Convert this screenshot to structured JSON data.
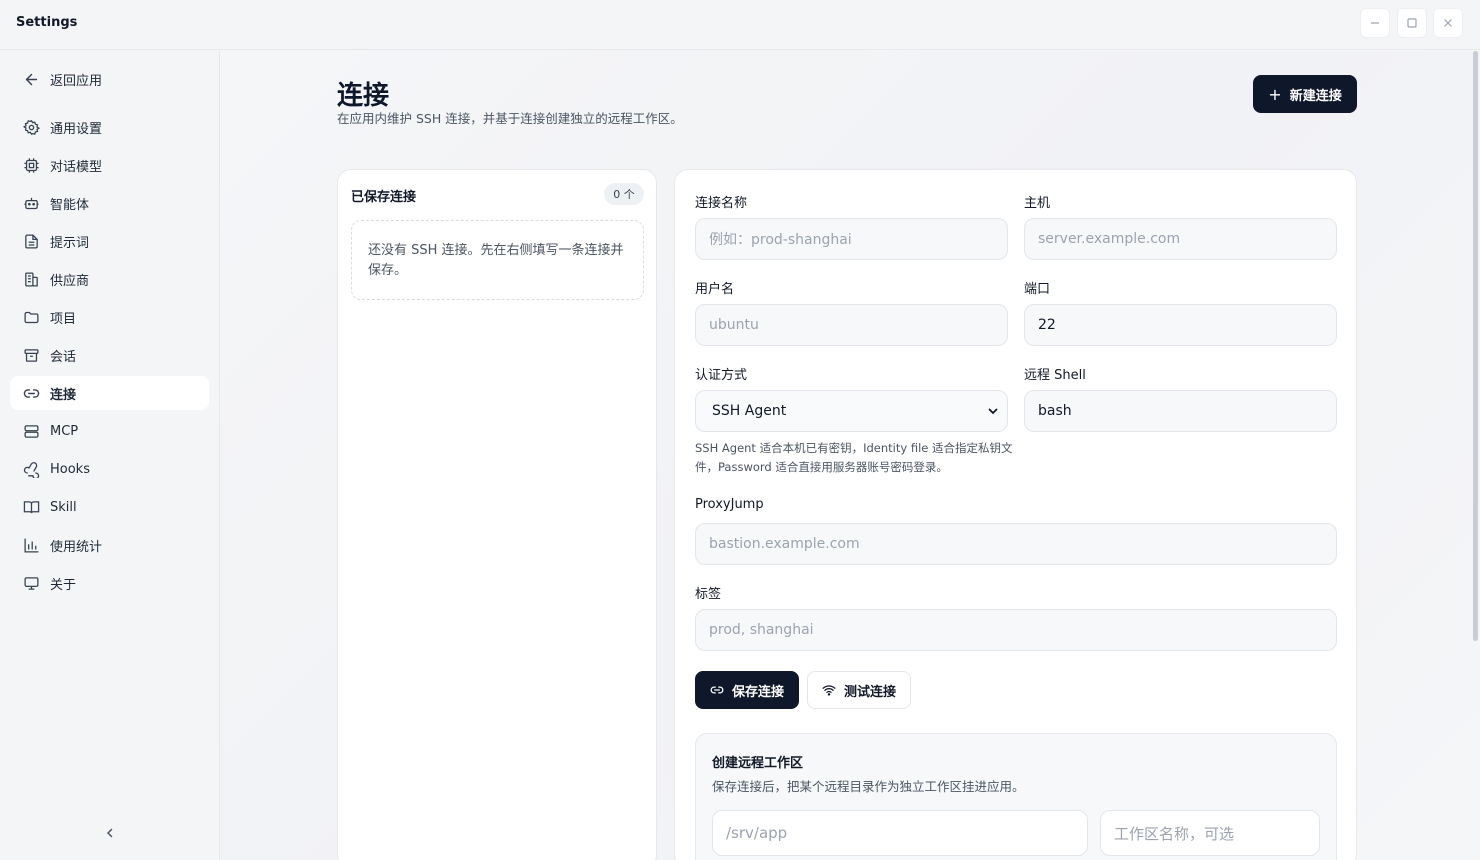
{
  "window": {
    "title": "Settings"
  },
  "sidebar": {
    "back_label": "返回应用",
    "items": [
      {
        "label": "通用设置",
        "icon": "gear-icon"
      },
      {
        "label": "对话模型",
        "icon": "cpu-icon"
      },
      {
        "label": "智能体",
        "icon": "bot-icon"
      },
      {
        "label": "提示词",
        "icon": "document-icon"
      },
      {
        "label": "供应商",
        "icon": "building-icon"
      },
      {
        "label": "项目",
        "icon": "folder-icon"
      },
      {
        "label": "会话",
        "icon": "archive-icon"
      },
      {
        "label": "连接",
        "icon": "link-icon",
        "active": true
      },
      {
        "label": "MCP",
        "icon": "server-icon"
      },
      {
        "label": "Hooks",
        "icon": "webhook-icon"
      },
      {
        "label": "Skill",
        "icon": "book-icon"
      },
      {
        "label": "使用统计",
        "icon": "chart-icon"
      },
      {
        "label": "关于",
        "icon": "monitor-icon"
      }
    ]
  },
  "header": {
    "title": "连接",
    "subtitle": "在应用内维护 SSH 连接，并基于连接创建独立的远程工作区。",
    "new_button": "新建连接"
  },
  "saved": {
    "title": "已保存连接",
    "count": "0 个",
    "empty_text": "还没有 SSH 连接。先在右侧填写一条连接并保存。"
  },
  "form": {
    "name_label": "连接名称",
    "name_placeholder": "例如：prod-shanghai",
    "host_label": "主机",
    "host_placeholder": "server.example.com",
    "user_label": "用户名",
    "user_placeholder": "ubuntu",
    "port_label": "端口",
    "port_value": "22",
    "auth_label": "认证方式",
    "auth_value": "SSH Agent",
    "shell_label": "远程 Shell",
    "shell_value": "bash",
    "auth_hint": "SSH Agent 适合本机已有密钥，Identity file 适合指定私钥文件，Password 适合直接用服务器账号密码登录。",
    "proxy_label": "ProxyJump",
    "proxy_placeholder": "bastion.example.com",
    "tags_label": "标签",
    "tags_placeholder": "prod, shanghai",
    "save_button": "保存连接",
    "test_button": "测试连接"
  },
  "workspace": {
    "title": "创建远程工作区",
    "subtitle": "保存连接后，把某个远程目录作为独立工作区挂进应用。",
    "path_placeholder": "/srv/app",
    "name_placeholder": "工作区名称，可选"
  },
  "colors": {
    "primary": "#0f172a",
    "active_bg": "#ffffff",
    "sidebar_bg": "#f4f5f7"
  }
}
